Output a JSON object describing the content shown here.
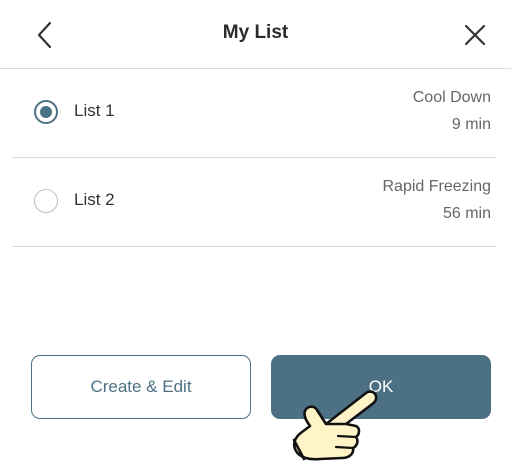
{
  "header": {
    "title": "My List",
    "back_icon": "chevron-left-icon",
    "close_icon": "close-icon"
  },
  "items": [
    {
      "label": "List 1",
      "mode": "Cool Down",
      "time": "9 min",
      "selected": true
    },
    {
      "label": "List 2",
      "mode": "Rapid Freezing",
      "time": "56 min",
      "selected": false
    }
  ],
  "buttons": {
    "create_edit_label": "Create & Edit",
    "ok_label": "OK"
  },
  "overlay": {
    "pointer_icon": "pointing-hand-icon"
  },
  "colors": {
    "accent": "#4d7184",
    "divider": "#dcdcdc",
    "hand_fill": "#fff4c8"
  }
}
